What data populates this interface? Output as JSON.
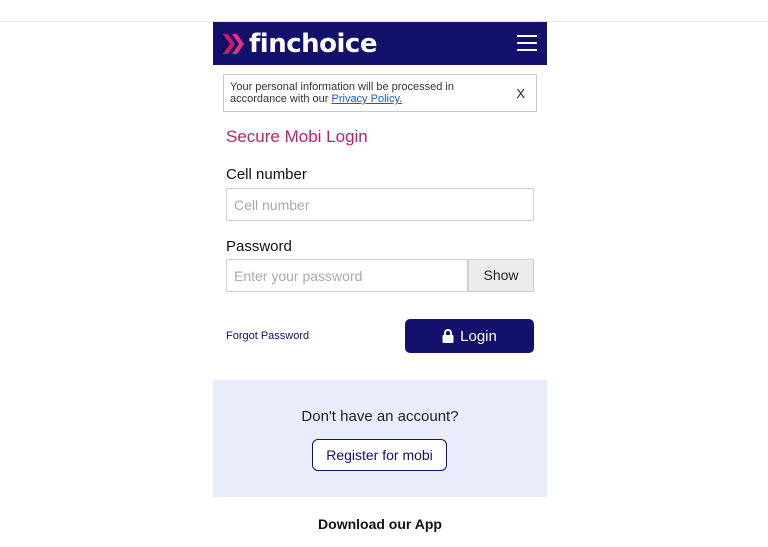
{
  "brand": {
    "logo_text": "finchoice",
    "accent": "#c71c68",
    "primary": "#13116b"
  },
  "notice": {
    "text": "Your personal information will be processed in accordance with our ",
    "link": "Privacy Policy.",
    "close": "X"
  },
  "login": {
    "heading": "Secure Mobi Login",
    "cell_label": "Cell number",
    "cell_placeholder": "Cell number",
    "password_label": "Password",
    "password_placeholder": "Enter your password",
    "show_label": "Show",
    "forgot_label": "Forgot Password",
    "login_label": "Login"
  },
  "register": {
    "question": "Don't have an account?",
    "button_label": "Register for mobi"
  },
  "footer": {
    "download_label": "Download our App"
  },
  "icons": [
    "double-chevron-logo-icon",
    "hamburger-menu-icon",
    "lock-icon"
  ]
}
